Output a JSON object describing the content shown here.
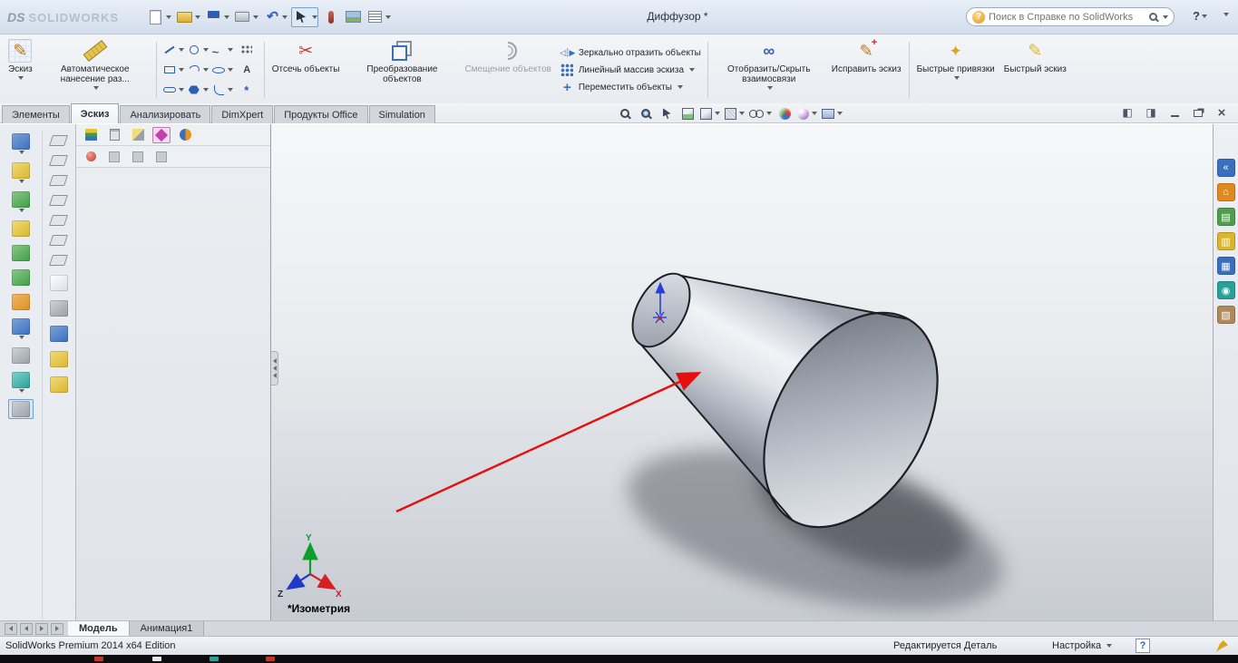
{
  "titlebar": {
    "logo_mark": "DS",
    "logo_text": "SOLIDWORKS",
    "doc_title": "Диффузор *",
    "search_placeholder": "Поиск в Справке по SolidWorks",
    "help_label": "?",
    "toolbar_icons": [
      "new-document-icon",
      "open-document-icon",
      "save-icon",
      "print-icon",
      "undo-icon",
      "select-cursor-icon",
      "color-swatch-icon",
      "image-icon",
      "options-list-icon"
    ]
  },
  "ribbon": {
    "buttons": {
      "sketch": "Эскиз",
      "auto_dimension": "Автоматическое нанесение раз...",
      "trim": "Отсечь объекты",
      "convert": "Преобразование объектов",
      "offset": "Смещение объектов",
      "mirror": "Зеркально отразить объекты",
      "linear_pattern": "Линейный массив эскиза",
      "move": "Переместить объекты",
      "relations": "Отобразить/Скрыть взаимосвязи",
      "repair": "Исправить эскиз",
      "snaps": "Быстрые привязки",
      "rapid": "Быстрый эскиз"
    },
    "sketch_tools": [
      "line",
      "circle",
      "spline",
      "grid",
      "rectangle",
      "arc",
      "ellipse",
      "text",
      "slot",
      "polygon",
      "fillet",
      "point"
    ],
    "tabs": [
      {
        "label": "Элементы",
        "active": false
      },
      {
        "label": "Эскиз",
        "active": true
      },
      {
        "label": "Анализировать",
        "active": false
      },
      {
        "label": "DimXpert",
        "active": false
      },
      {
        "label": "Продукты Office",
        "active": false
      },
      {
        "label": "Simulation",
        "active": false
      }
    ]
  },
  "headsup_icons": [
    "zoom-fit-icon",
    "zoom-area-icon",
    "previous-view-icon",
    "section-view-icon",
    "view-orientation-icon",
    "display-style-icon",
    "hide-show-items-icon",
    "edit-appearance-icon",
    "apply-scene-icon",
    "view-settings-icon"
  ],
  "window_controls": [
    "pane-left-icon",
    "pane-right-icon",
    "minimize-icon",
    "restore-icon",
    "close-icon"
  ],
  "left_toolbar": {
    "column1": [
      "sketch-tools-icon",
      "dimension-tools-icon",
      "extrude-tools-icon",
      "revolve-icon",
      "boss-icon",
      "cut-icon",
      "fillet-icon",
      "pattern-icon",
      "reference-icon",
      "spline-tools-icon",
      "active-sketch-tool-icon"
    ],
    "column2": [
      "plane-icon",
      "plane-icon",
      "plane-icon",
      "plane-icon",
      "plane-icon",
      "plane-icon",
      "plane-icon",
      "notebook-icon",
      "measure-icon",
      "exchange-icon",
      "sheet-icon",
      "sheet-icon"
    ]
  },
  "feature_panel": {
    "tabs": [
      "feature-tree-icon",
      "property-manager-icon",
      "configuration-manager-icon",
      "dimxpert-manager-icon",
      "display-manager-icon"
    ],
    "subrow": [
      "sensor-icon",
      "annotations-icon",
      "material-icon",
      "history-icon"
    ]
  },
  "taskpane_icons": [
    "resources-icon",
    "home-icon",
    "design-library-icon",
    "file-explorer-icon",
    "view-palette-icon",
    "appearances-icon",
    "custom-properties-icon"
  ],
  "viewport": {
    "view_label": "*Изометрия",
    "axes": {
      "x": "X",
      "y": "Y",
      "z": "Z"
    }
  },
  "model_tabs": [
    {
      "label": "Модель",
      "active": true
    },
    {
      "label": "Анимация1",
      "active": false
    }
  ],
  "statusbar": {
    "edition": "SolidWorks Premium 2014 x64 Edition",
    "mode": "Редактируется Деталь",
    "settings": "Настройка"
  }
}
